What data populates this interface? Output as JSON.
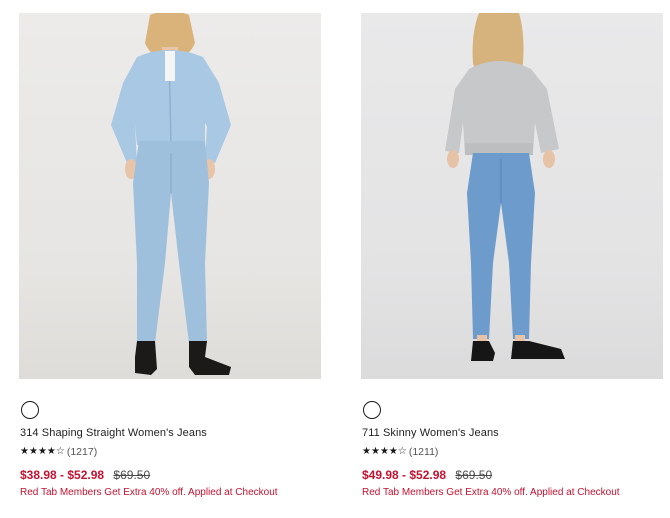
{
  "colors": {
    "sale": "#c41230",
    "text": "#1a1a1a"
  },
  "products": [
    {
      "name": "314 Shaping Straight Women's Jeans",
      "rating_stars": 4.5,
      "rating_count": "(1217)",
      "sale_price": "$38.98 - $52.98",
      "original_price": "$69.50",
      "promo": "Red Tab Members Get Extra 40% off. Applied at Checkout",
      "swatch_color": "#ffffff"
    },
    {
      "name": "711 Skinny Women's Jeans",
      "rating_stars": 4.5,
      "rating_count": "(1211)",
      "sale_price": "$49.98 - $52.98",
      "original_price": "$69.50",
      "promo": "Red Tab Members Get Extra 40% off. Applied at Checkout",
      "swatch_color": "#ffffff"
    }
  ]
}
